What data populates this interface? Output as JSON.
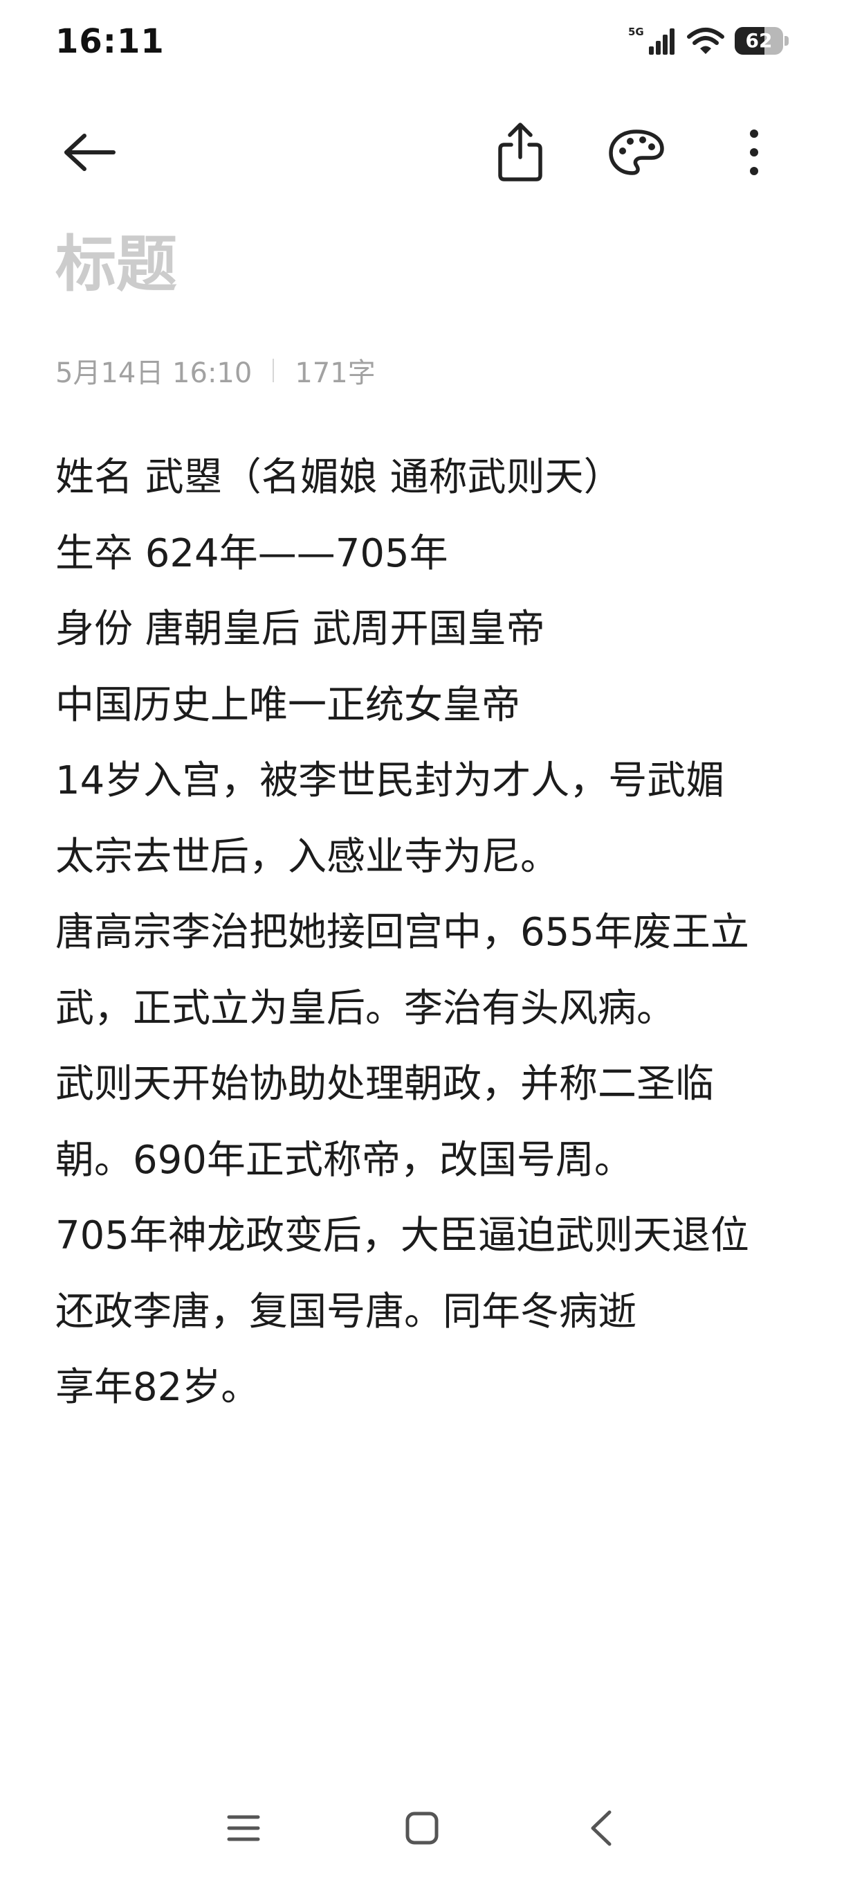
{
  "status_bar": {
    "time": "16:11",
    "network_label": "5G",
    "battery_level": "62",
    "battery_fraction": 0.62,
    "icons": [
      "cellular-signal-icon",
      "wifi-icon",
      "battery-icon"
    ]
  },
  "toolbar": {
    "icons": [
      "back-arrow-icon",
      "share-icon",
      "palette-icon",
      "more-vertical-icon"
    ]
  },
  "note": {
    "title_placeholder": "标题",
    "date": "5月14日 16:10",
    "word_count": "171字",
    "lines": [
      "姓名 武曌（名媚娘 通称武则天）",
      "生卒 624年——705年",
      "身份 唐朝皇后 武周开国皇帝",
      "中国历史上唯一正统女皇帝",
      "14岁入宫，被李世民封为才人，号武媚",
      "太宗去世后，入感业寺为尼。",
      "唐高宗李治把她接回宫中，655年废王立",
      "武，正式立为皇后。李治有头风病。",
      "武则天开始协助处理朝政，并称二圣临",
      "朝。690年正式称帝，改国号周。",
      "705年神龙政变后，大臣逼迫武则天退位",
      "还政李唐，复国号唐。同年冬病逝",
      "享年82岁。"
    ]
  },
  "nav_bar": {
    "icons": [
      "menu-icon",
      "home-icon",
      "back-icon"
    ]
  },
  "colors": {
    "text": "#1c1c1c",
    "placeholder": "#cccccc",
    "meta": "#a2a2a2",
    "icon": "#222222"
  }
}
